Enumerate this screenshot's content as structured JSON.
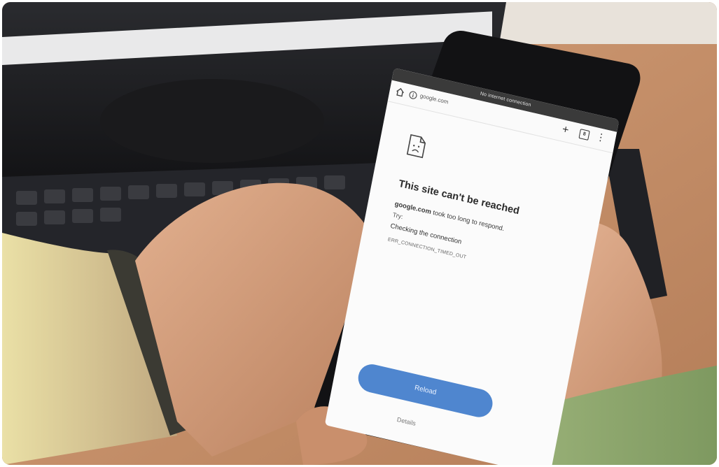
{
  "photo": {
    "description_colors": {
      "desk": "#b88c6a",
      "monitor": "#1c1c1e",
      "keyboard": "#2a2b2e",
      "skin": "#d9a785",
      "sleeve_left": "#c9b08a",
      "sleeve_right": "#8da56a",
      "phone_body": "#121214"
    }
  },
  "phone": {
    "status_text": "No internet connection",
    "browser": {
      "url": "google.com",
      "tab_count": "8"
    },
    "error_page": {
      "title": "This site can't be reached",
      "domain": "google.com",
      "message": "took too long to respond.",
      "try_label": "Try:",
      "suggestion": "Checking the connection",
      "error_code": "ERR_CONNECTION_TIMED_OUT",
      "reload_label": "Reload",
      "details_label": "Details"
    }
  }
}
